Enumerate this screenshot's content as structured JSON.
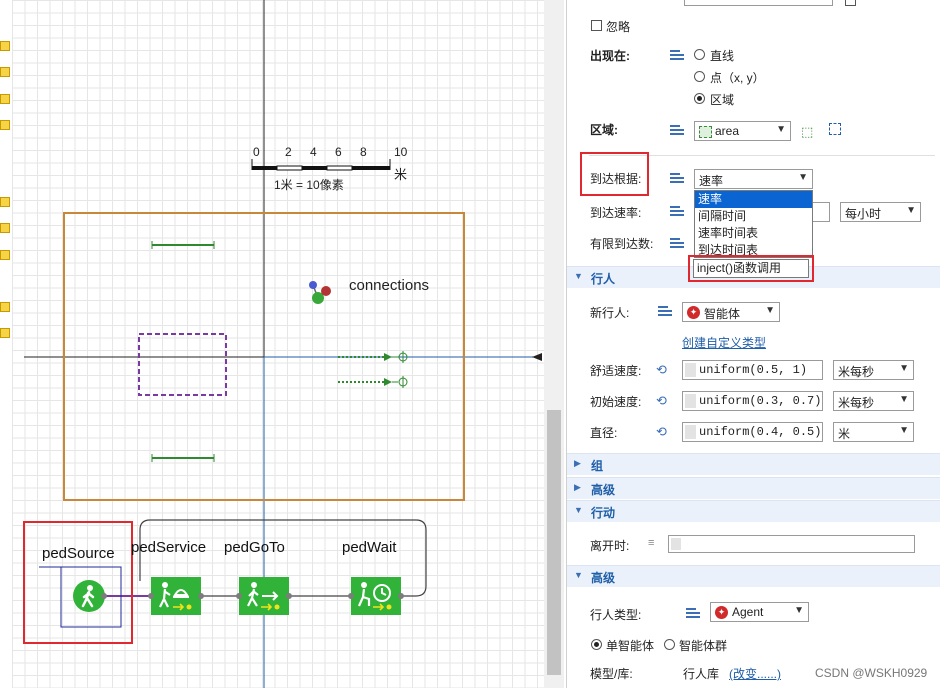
{
  "canvas": {
    "scale_ticks": [
      "0",
      "2",
      "4",
      "6",
      "8",
      "10"
    ],
    "scale_unit": "米",
    "scale_caption": "1米 = 10像素",
    "connections_label": "connections",
    "blocks": [
      {
        "label": "pedSource",
        "icon": "walking-person-icon"
      },
      {
        "label": "pedService",
        "icon": "service-icon"
      },
      {
        "label": "pedGoTo",
        "icon": "go-to-icon"
      },
      {
        "label": "pedWait",
        "icon": "wait-icon"
      }
    ]
  },
  "props": {
    "ignore_label": "忽略",
    "appear_label": "出现在:",
    "appear_options": [
      "直线",
      "点（x, y）",
      "区域"
    ],
    "appear_selected": "区域",
    "area_label": "区域:",
    "area_value": "area",
    "arrival_label": "到达根据:",
    "arrival_value": "速率",
    "arrival_options": [
      "速率",
      "间隔时间",
      "速率时间表",
      "到达时间表"
    ],
    "arrival_extra_option": "inject()函数调用",
    "rate_label": "到达速率:",
    "rate_unit": "每小时",
    "limited_label": "有限到达数:",
    "section_ped": "行人",
    "new_ped_label": "新行人:",
    "new_ped_value": "智能体",
    "create_type_link": "创建自定义类型",
    "comfort_label": "舒适速度:",
    "comfort_value": "uniform(0.5, 1)",
    "comfort_unit": "米每秒",
    "initial_label": "初始速度:",
    "initial_value": "uniform(0.3, 0.7)",
    "initial_unit": "米每秒",
    "diameter_label": "直径:",
    "diameter_value": "uniform(0.4, 0.5)",
    "diameter_unit": "米",
    "section_group": "组",
    "section_advanced": "高级",
    "section_action": "行动",
    "leave_label": "离开时:",
    "section_advanced2": "高级",
    "ped_type_label": "行人类型:",
    "ped_type_value": "Agent",
    "single_agent": "单智能体",
    "agent_group": "智能体群",
    "model_label": "模型/库:",
    "model_value": "行人库",
    "change_link": "(改变......)",
    "watermark": "CSDN @WSKH0929"
  },
  "colors": {
    "selection": "#0a64d2",
    "highlight_box": "#e0282e",
    "block_green": "#30b338",
    "area_border": "#c8883a",
    "link": "#1f5ea8"
  }
}
